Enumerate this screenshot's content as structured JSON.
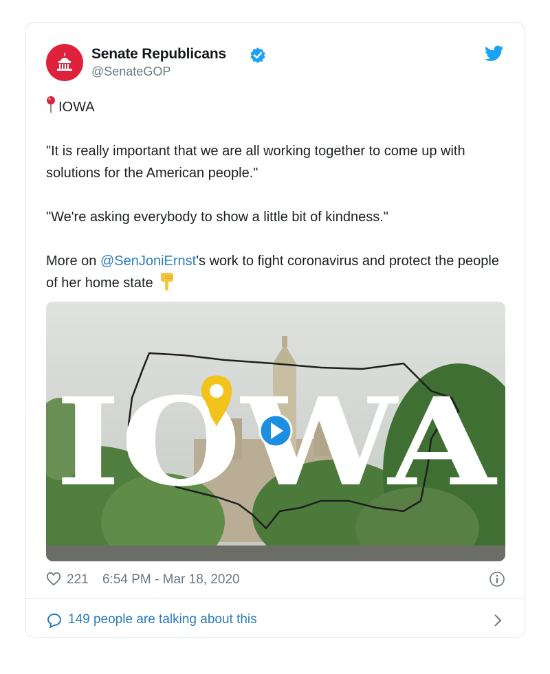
{
  "tweet": {
    "display_name": "Senate Republicans",
    "handle": "@SenateGOP",
    "verified": true,
    "location_line": "IOWA",
    "quote_1": "\"It is really important that we are all working together to come up with solutions for the American people.\"",
    "quote_2": "\"We're asking everybody to show a little bit of kindness.\"",
    "more_prefix": "More on ",
    "mention": "@SenJoniErnst",
    "more_suffix": "'s work to fight coronavirus and protect the people of her home state",
    "media_overlay_text": "IOWA",
    "likes": "221",
    "timestamp": "6:54 PM - Mar 18, 2020",
    "talking": "149 people are talking about this"
  },
  "icons": {
    "avatar": "capitol-icon",
    "verified": "verified-badge-icon",
    "brand": "twitter-bird-icon",
    "pin": "round-pushpin-icon",
    "point": "pointing-down-icon",
    "play": "play-icon",
    "like": "heart-icon",
    "info": "info-icon",
    "reply": "speech-bubble-icon",
    "more": "chevron-right-icon"
  },
  "colors": {
    "avatar_bg": "#e0213b",
    "verified": "#1da1f2",
    "link": "#2b7bb9",
    "muted": "#697882",
    "play": "#1d8fe0",
    "pin_yellow": "#f2c31b"
  }
}
